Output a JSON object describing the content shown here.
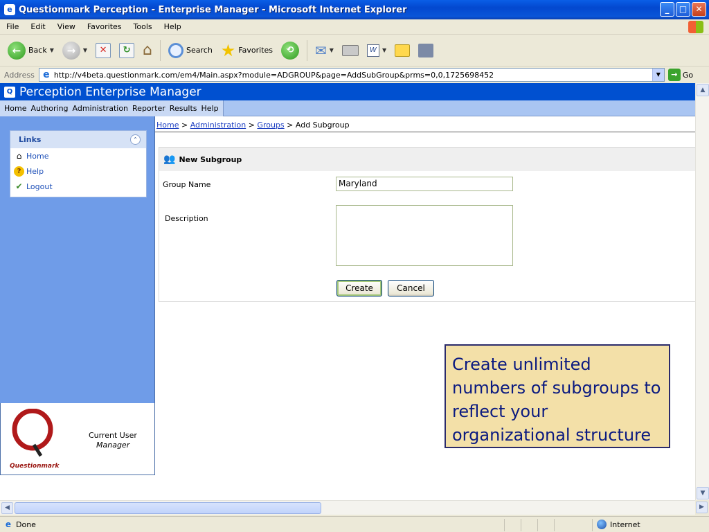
{
  "window": {
    "title": "Questionmark Perception - Enterprise Manager - Microsoft Internet Explorer",
    "controls": {
      "minimize": "_",
      "maximize": "□",
      "close": "✕"
    }
  },
  "menubar": [
    "File",
    "Edit",
    "View",
    "Favorites",
    "Tools",
    "Help"
  ],
  "toolbar": {
    "back_label": "Back",
    "search_label": "Search",
    "favorites_label": "Favorites"
  },
  "address": {
    "label": "Address",
    "url": "http://v4beta.questionmark.com/em4/Main.aspx?module=ADGROUP&page=AddSubGroup&prms=0,0,1725698452",
    "go_label": "Go"
  },
  "app": {
    "title": "Perception Enterprise Manager",
    "nav": [
      "Home",
      "Authoring",
      "Administration",
      "Reporter",
      "Results",
      "Help"
    ]
  },
  "links": {
    "title": "Links",
    "items": [
      {
        "label": "Home",
        "icon": "home-icon"
      },
      {
        "label": "Help",
        "icon": "help-icon"
      },
      {
        "label": "Logout",
        "icon": "logout-icon"
      }
    ]
  },
  "user": {
    "brand": "Questionmark",
    "label": "Current User",
    "name": "Manager"
  },
  "breadcrumb": {
    "home": "Home",
    "sep": " > ",
    "administration": "Administration",
    "groups": "Groups",
    "current": "Add Subgroup"
  },
  "form": {
    "title": "New Subgroup",
    "group_name_label": "Group Name",
    "group_name_value": "Maryland",
    "description_label": "Description",
    "create_label": "Create",
    "cancel_label": "Cancel"
  },
  "callout": {
    "text": "Create unlimited numbers of subgroups to reflect your organizational structure"
  },
  "status": {
    "text": "Done",
    "zone": "Internet"
  }
}
